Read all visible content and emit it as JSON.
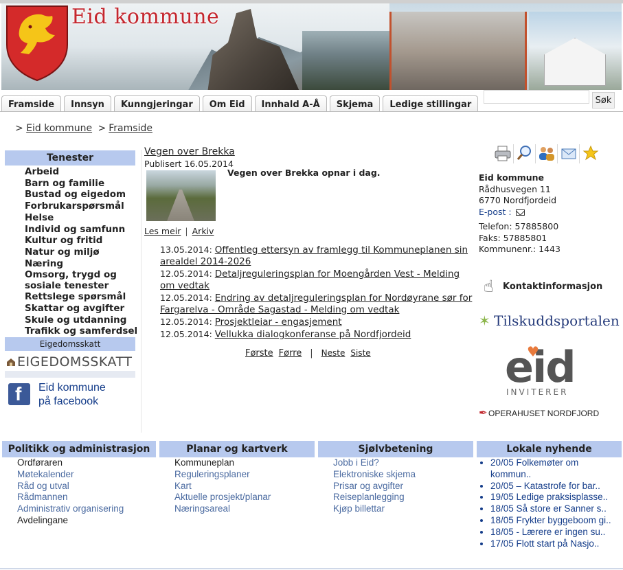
{
  "header": {
    "logo_text": "Eid kommune",
    "accent": "#c4262e"
  },
  "nav": {
    "tabs": [
      "Framside",
      "Innsyn",
      "Kunngjeringar",
      "Om Eid",
      "Innhald A-Å",
      "Skjema",
      "Ledige stillingar"
    ],
    "search_placeholder": "",
    "search_value": "",
    "search_button": "Søk"
  },
  "breadcrumb": {
    "prefix": ">",
    "items": [
      "Eid kommune",
      "Framside"
    ],
    "sep": ">"
  },
  "sidebar": {
    "heading": "Tenester",
    "items": [
      "Arbeid",
      "Barn og familie",
      "Bustad og eigedom",
      "Forbrukarspørsmål",
      "Helse",
      "Individ og samfunn",
      "Kultur og fritid",
      "Natur og miljø",
      "Næring",
      "Omsorg, trygd og",
      "sosiale tenester",
      "Rettslege spørsmål",
      "Skattar og avgifter",
      "Skule og utdanning",
      "Trafikk og samferdsel"
    ],
    "subheading": "Eigedomsskatt",
    "eskatt_banner": "EIGEDOMSSKATT",
    "facebook_line1": "Eid kommune",
    "facebook_line2": "på facebook",
    "facebook_icon": "f"
  },
  "main": {
    "article": {
      "title": "Vegen over Brekka",
      "published": "Publisert 16.05.2014",
      "lead": "Vegen over Brekka opnar i dag.",
      "read_more": "Les meir",
      "archive": "Arkiv",
      "links_sep": "|"
    },
    "news": [
      {
        "date": "13.05.2014:",
        "title": "Offentleg ettersyn av framlegg til Kommuneplanen sin arealdel 2014-2026"
      },
      {
        "date": "12.05.2014:",
        "title": "Detaljreguleringsplan for Moengården Vest - Melding om vedtak"
      },
      {
        "date": "12.05.2014:",
        "title": "Endring av detaljreguleringsplan for Nordøyrane sør for Fargarelva - Område Sagastad - Melding om vedtak"
      },
      {
        "date": "12.05.2014:",
        "title": "Prosjektleiar - engasjement"
      },
      {
        "date": "12.05.2014:",
        "title": "Vellukka dialogkonferanse på Nordfjordeid"
      }
    ],
    "pager": {
      "first": "Første",
      "prev": "Førre",
      "sep": "|",
      "next": "Neste",
      "last": "Siste"
    }
  },
  "right": {
    "contact": {
      "name": "Eid kommune",
      "street": "Rådhusvegen 11",
      "postal": "6770 Nordfjordeid",
      "email_label": "E-post",
      "email_colon": " :",
      "phone": "Telefon: 57885800",
      "fax": "Faks: 57885801",
      "orgnr": "Kommunenr.: 1443"
    },
    "tools": [
      "printer-icon",
      "zoom-icon",
      "users-icon",
      "email-icon",
      "favourite-star-icon"
    ],
    "kontakt_label": "Kontaktinformasjon",
    "tilskudd_label": "Tilskuddsportalen",
    "eid_word": "eid",
    "eid_sub": "INVITERER",
    "opera_label": "OPERAHUSET NORDFJORD"
  },
  "footer": {
    "columns": [
      {
        "heading": "Politikk og administrasjon",
        "items": [
          "Ordføraren",
          "Møtekalender",
          "Råd og utval",
          "Rådmannen",
          "Administrativ organisering",
          "Avdelingane"
        ]
      },
      {
        "heading": "Planar og kartverk",
        "items": [
          "Kommuneplan",
          "Reguleringsplaner",
          "Kart",
          "Aktuelle prosjekt/planar",
          "Næringsareal"
        ]
      },
      {
        "heading": "Sjølvbetening",
        "items": [
          "Jobb i Eid?",
          "Elektroniske skjema",
          "Prisar og avgifter",
          "Reiseplanlegging",
          "Kjøp billettar"
        ]
      },
      {
        "heading": "Lokale nyhende",
        "items": [
          "20/05  Folkemøter om kommun..",
          "20/05  – Katastrofe for bar..",
          "19/05  Ledige praksisplasse..",
          "18/05  Så store er Sanner s..",
          "18/05  Frykter byggeboom gi..",
          "18/05  - Lærere er ingen su..",
          "17/05  Flott start på Nasjo.."
        ]
      }
    ]
  },
  "colors": {
    "section_header_bg": "#b7c9ee",
    "link_blue": "#153d8a",
    "footer_link": "#4a6aa0"
  }
}
